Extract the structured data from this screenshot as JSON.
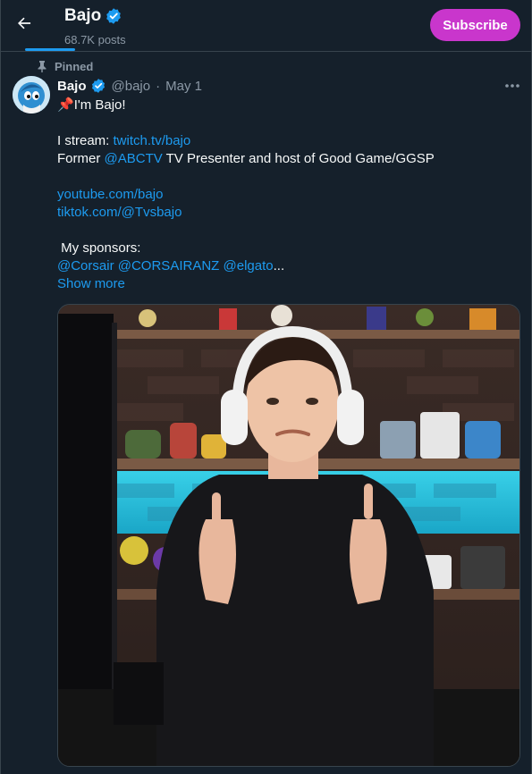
{
  "header": {
    "name": "Bajo",
    "posts_count": "68.7K posts",
    "subscribe_label": "Subscribe",
    "back_icon": "arrow-left-icon",
    "verified_icon": "verified-badge-icon"
  },
  "tweet": {
    "pinned_label": "Pinned",
    "author_name": "Bajo",
    "handle": "@bajo",
    "separator": "·",
    "date": "May 1",
    "intro_emoji": "📌",
    "intro_text": "I'm Bajo!",
    "stream_prefix": "I stream: ",
    "stream_link": "twitch.tv/bajo",
    "former_prefix": "Former ",
    "former_mention": "@ABCTV",
    "former_suffix": " TV Presenter and host of Good Game/GGSP",
    "youtube_link": "youtube.com/bajo",
    "tiktok_link": "tiktok.com/@Tvsbajo",
    "sponsors_label": " My sponsors:",
    "sponsor_1": "@Corsair",
    "sponsor_2": "@CORSAIRANZ",
    "sponsor_3": "@elgato",
    "ellipsis": "...",
    "show_more": "Show more"
  },
  "colors": {
    "background": "#15202b",
    "accent": "#1d9bf0",
    "subscribe": "#c936cc",
    "secondary_text": "#8b98a5"
  }
}
